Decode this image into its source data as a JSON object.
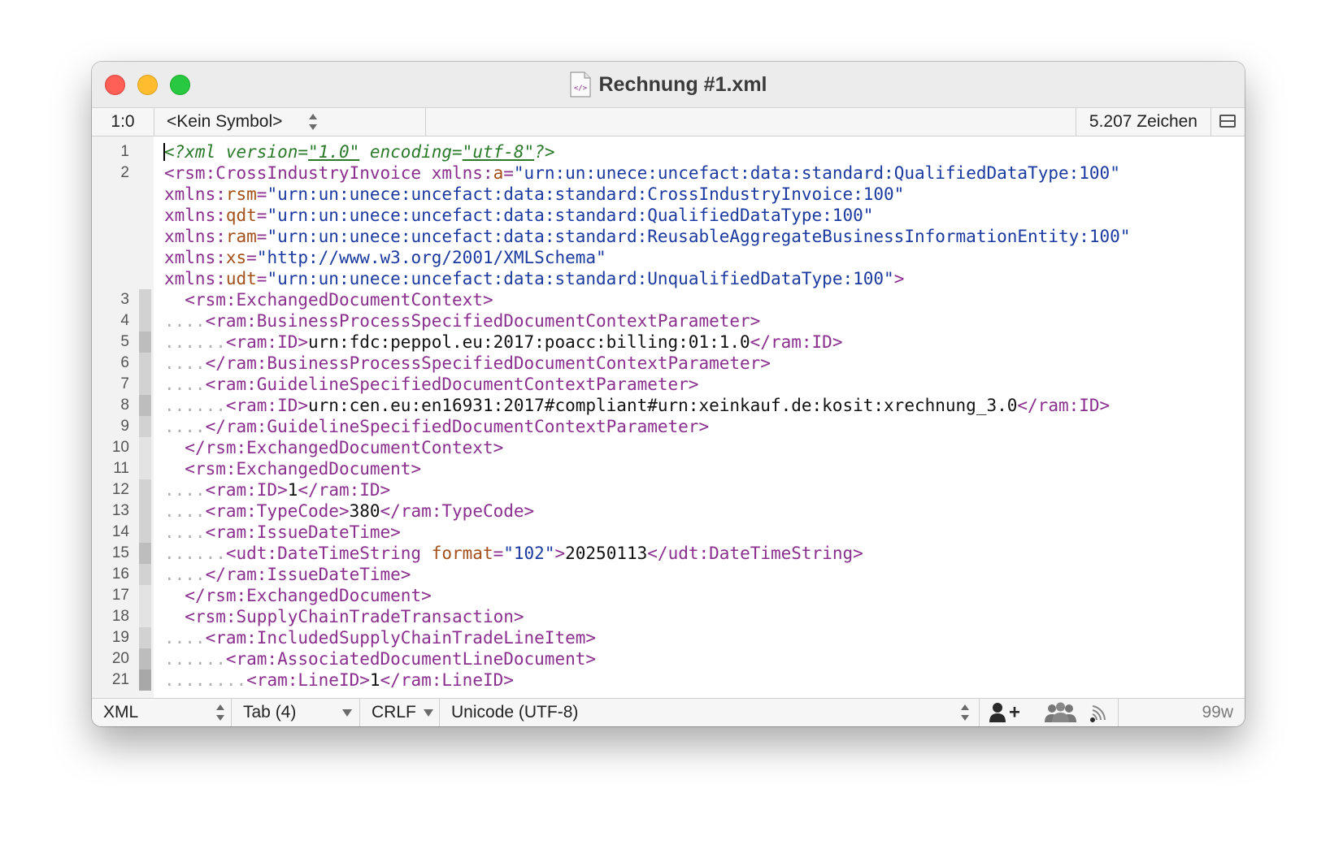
{
  "window": {
    "title": "Rechnung #1.xml",
    "file_icon": "xml-document-icon"
  },
  "navbar": {
    "cursor_position": "1:0",
    "symbol": "<Kein Symbol>",
    "char_count": "5.207 Zeichen"
  },
  "editor": {
    "colors": {
      "tag": "#8a2f8e",
      "attr": "#a3501a",
      "value": "#1b3aa0",
      "text": "#111111",
      "decl": "#2a7a2a",
      "dots": "#b0b0b0"
    },
    "lines": [
      {
        "n": "1",
        "indent": "",
        "fold": "none",
        "segs": [
          [
            "decl",
            "<?xml version="
          ],
          [
            "decl-u",
            "\"1.0\""
          ],
          [
            "decl",
            " encoding="
          ],
          [
            "decl-u",
            "\"utf-8\""
          ],
          [
            "decl",
            "?>"
          ]
        ]
      },
      {
        "n": "2",
        "indent": "",
        "fold": "none",
        "segs": [
          [
            "tag",
            "<rsm:CrossIndustryInvoice "
          ],
          [
            "tag",
            "xmlns:"
          ],
          [
            "attr",
            "a"
          ],
          [
            "tag",
            "="
          ],
          [
            "value",
            "\"urn:un:unece:uncefact:data:standard:QualifiedDataType:100\""
          ]
        ]
      },
      {
        "n": "",
        "indent": "",
        "fold": "none",
        "segs": [
          [
            "tag",
            "xmlns:"
          ],
          [
            "attr",
            "rsm"
          ],
          [
            "tag",
            "="
          ],
          [
            "value",
            "\"urn:un:unece:uncefact:data:standard:CrossIndustryInvoice:100\""
          ]
        ]
      },
      {
        "n": "",
        "indent": "",
        "fold": "none",
        "segs": [
          [
            "tag",
            "xmlns:"
          ],
          [
            "attr",
            "qdt"
          ],
          [
            "tag",
            "="
          ],
          [
            "value",
            "\"urn:un:unece:uncefact:data:standard:QualifiedDataType:100\""
          ]
        ]
      },
      {
        "n": "",
        "indent": "",
        "fold": "none",
        "segs": [
          [
            "tag",
            "xmlns:"
          ],
          [
            "attr",
            "ram"
          ],
          [
            "tag",
            "="
          ],
          [
            "value",
            "\"urn:un:unece:uncefact:data:standard:ReusableAggregateBusinessInformationEntity:100\""
          ]
        ]
      },
      {
        "n": "",
        "indent": "",
        "fold": "none",
        "segs": [
          [
            "tag",
            "xmlns:"
          ],
          [
            "attr",
            "xs"
          ],
          [
            "tag",
            "="
          ],
          [
            "value",
            "\"http://www.w3.org/2001/XMLSchema\""
          ]
        ]
      },
      {
        "n": "",
        "indent": "",
        "fold": "none",
        "segs": [
          [
            "tag",
            "xmlns:"
          ],
          [
            "attr",
            "udt"
          ],
          [
            "tag",
            "="
          ],
          [
            "value",
            "\"urn:un:unece:uncefact:data:standard:UnqualifiedDataType:100\""
          ],
          [
            "tag",
            ">"
          ]
        ]
      },
      {
        "n": "3",
        "indent": "  ",
        "fold": "l1",
        "segs": [
          [
            "tag",
            "<rsm:ExchangedDocumentContext>"
          ]
        ]
      },
      {
        "n": "4",
        "indent": "....",
        "fold": "l1",
        "segs": [
          [
            "tag",
            "<ram:BusinessProcessSpecifiedDocumentContextParameter>"
          ]
        ]
      },
      {
        "n": "5",
        "indent": "......",
        "fold": "l2",
        "segs": [
          [
            "tag",
            "<ram:ID>"
          ],
          [
            "text",
            "urn:fdc:peppol.eu:2017:poacc:billing:01:1.0"
          ],
          [
            "tag",
            "</ram:ID>"
          ]
        ]
      },
      {
        "n": "6",
        "indent": "....",
        "fold": "l1",
        "segs": [
          [
            "tag",
            "</ram:BusinessProcessSpecifiedDocumentContextParameter>"
          ]
        ]
      },
      {
        "n": "7",
        "indent": "....",
        "fold": "l1",
        "segs": [
          [
            "tag",
            "<ram:GuidelineSpecifiedDocumentContextParameter>"
          ]
        ]
      },
      {
        "n": "8",
        "indent": "......",
        "fold": "l2",
        "segs": [
          [
            "tag",
            "<ram:ID>"
          ],
          [
            "text",
            "urn:cen.eu:en16931:2017#compliant#urn:xeinkauf.de:kosit:xrechnung_3.0"
          ],
          [
            "tag",
            "</ram:ID>"
          ]
        ]
      },
      {
        "n": "9",
        "indent": "....",
        "fold": "l1",
        "segs": [
          [
            "tag",
            "</ram:GuidelineSpecifiedDocumentContextParameter>"
          ]
        ]
      },
      {
        "n": "10",
        "indent": "  ",
        "fold": "l0",
        "segs": [
          [
            "tag",
            "</rsm:ExchangedDocumentContext>"
          ]
        ]
      },
      {
        "n": "11",
        "indent": "  ",
        "fold": "l0",
        "segs": [
          [
            "tag",
            "<rsm:ExchangedDocument>"
          ]
        ]
      },
      {
        "n": "12",
        "indent": "....",
        "fold": "l1",
        "segs": [
          [
            "tag",
            "<ram:ID>"
          ],
          [
            "text",
            "1"
          ],
          [
            "tag",
            "</ram:ID>"
          ]
        ]
      },
      {
        "n": "13",
        "indent": "....",
        "fold": "l1",
        "segs": [
          [
            "tag",
            "<ram:TypeCode>"
          ],
          [
            "text",
            "380"
          ],
          [
            "tag",
            "</ram:TypeCode>"
          ]
        ]
      },
      {
        "n": "14",
        "indent": "....",
        "fold": "l1",
        "segs": [
          [
            "tag",
            "<ram:IssueDateTime>"
          ]
        ]
      },
      {
        "n": "15",
        "indent": "......",
        "fold": "l2",
        "segs": [
          [
            "tag",
            "<udt:DateTimeString "
          ],
          [
            "attr",
            "format"
          ],
          [
            "tag",
            "="
          ],
          [
            "value",
            "\"102\""
          ],
          [
            "tag",
            ">"
          ],
          [
            "text",
            "20250113"
          ],
          [
            "tag",
            "</udt:DateTimeString>"
          ]
        ]
      },
      {
        "n": "16",
        "indent": "....",
        "fold": "l1",
        "segs": [
          [
            "tag",
            "</ram:IssueDateTime>"
          ]
        ]
      },
      {
        "n": "17",
        "indent": "  ",
        "fold": "l0",
        "segs": [
          [
            "tag",
            "</rsm:ExchangedDocument>"
          ]
        ]
      },
      {
        "n": "18",
        "indent": "  ",
        "fold": "l0",
        "segs": [
          [
            "tag",
            "<rsm:SupplyChainTradeTransaction>"
          ]
        ]
      },
      {
        "n": "19",
        "indent": "....",
        "fold": "l1",
        "segs": [
          [
            "tag",
            "<ram:IncludedSupplyChainTradeLineItem>"
          ]
        ]
      },
      {
        "n": "20",
        "indent": "......",
        "fold": "l2",
        "segs": [
          [
            "tag",
            "<ram:AssociatedDocumentLineDocument>"
          ]
        ]
      },
      {
        "n": "21",
        "indent": "........",
        "fold": "l3",
        "segs": [
          [
            "tag",
            "<ram:LineID>"
          ],
          [
            "text",
            "1"
          ],
          [
            "tag",
            "</ram:LineID>"
          ]
        ]
      }
    ]
  },
  "statusbar": {
    "syntax": "XML",
    "tab": "Tab (4)",
    "line_ending": "CRLF",
    "encoding": "Unicode (UTF-8)",
    "icons": [
      "add-user-icon",
      "group-icon",
      "signal-icon"
    ],
    "width": "99w"
  }
}
